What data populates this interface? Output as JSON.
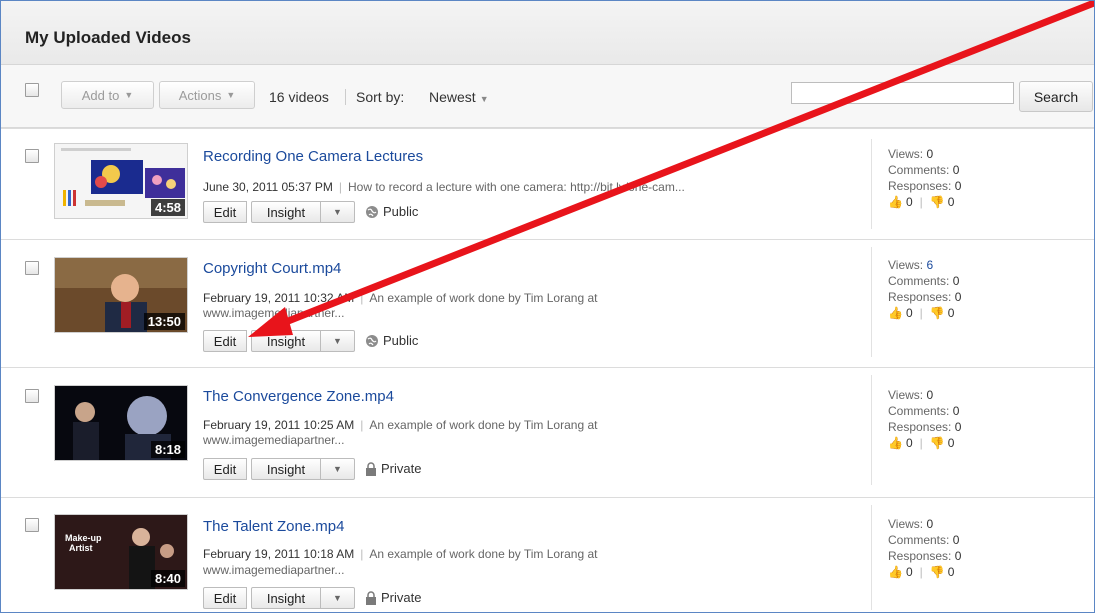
{
  "page": {
    "title": "My Uploaded Videos"
  },
  "toolbar": {
    "add_to_label": "Add to",
    "actions_label": "Actions",
    "video_count": "16 videos",
    "sort_label": "Sort by:",
    "sort_value": "Newest",
    "search_value": "",
    "search_button_label": "Search"
  },
  "labels": {
    "edit": "Edit",
    "insight": "Insight",
    "views": "Views:",
    "comments": "Comments:",
    "responses": "Responses:"
  },
  "videos": [
    {
      "title": "Recording One Camera Lectures",
      "date": "June 30, 2011 05:37 PM",
      "description": "How to record a lecture with one camera: http://bit.ly/one-cam...",
      "url": "",
      "duration": "4:58",
      "privacy": "Public",
      "views": "0",
      "comments": "0",
      "responses": "0",
      "likes": "0",
      "dislikes": "0"
    },
    {
      "title": "Copyright Court.mp4",
      "date": "February 19, 2011 10:32 AM",
      "description": "An example of work done by Tim Lorang at",
      "url": "www.imagemediapartner...",
      "duration": "13:50",
      "privacy": "Public",
      "views": "6",
      "comments": "0",
      "responses": "0",
      "likes": "0",
      "dislikes": "0"
    },
    {
      "title": "The Convergence Zone.mp4",
      "date": "February 19, 2011 10:25 AM",
      "description": "An example of work done by Tim Lorang at",
      "url": "www.imagemediapartner...",
      "duration": "8:18",
      "privacy": "Private",
      "views": "0",
      "comments": "0",
      "responses": "0",
      "likes": "0",
      "dislikes": "0"
    },
    {
      "title": "The Talent Zone.mp4",
      "date": "February 19, 2011 10:18 AM",
      "description": "An example of work done by Tim Lorang at",
      "url": "www.imagemediapartner...",
      "duration": "8:40",
      "privacy": "Private",
      "views": "0",
      "comments": "0",
      "responses": "0",
      "likes": "0",
      "dislikes": "0"
    }
  ],
  "colors": {
    "link": "#1b4a9c",
    "annotation_arrow": "#e8141b",
    "frame_border": "#5b86c4"
  },
  "icons": {
    "public": "globe-icon",
    "private": "lock-icon",
    "like": "thumbs-up-icon",
    "dislike": "thumbs-down-icon"
  }
}
